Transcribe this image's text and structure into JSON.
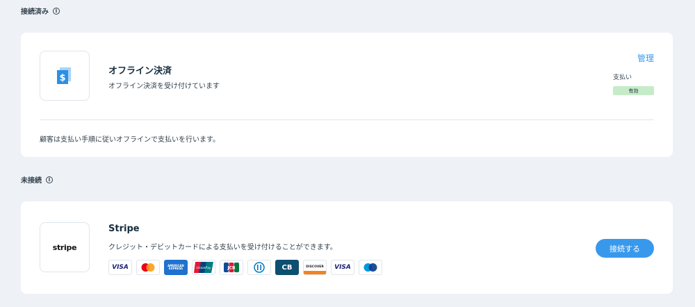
{
  "connected_section": {
    "label": "接続済み"
  },
  "offline": {
    "title": "オフライン決済",
    "description": "オフライン決済を受け付けています",
    "manage": "管理",
    "pay_label": "支払い",
    "status": "有効",
    "footer": "顧客は支払い手順に従いオフラインで支払いを行います。"
  },
  "unconnected_section": {
    "label": "未接続"
  },
  "stripe": {
    "logo_text": "stripe",
    "title": "Stripe",
    "description": "クレジット・デビットカードによる支払いを受け付けることができます。",
    "connect": "接続する",
    "card_icons": [
      "visa-icon",
      "mastercard-icon",
      "amex-icon",
      "unionpay-icon",
      "jcb-icon",
      "diners-icon",
      "cb-icon",
      "discover-icon",
      "visa-icon",
      "maestro-icon"
    ],
    "card_labels": {
      "visa": "VISA",
      "amex": "AMERICAN EXPRESS",
      "unionpay": "UnionPay",
      "jcb": "JCB",
      "cb": "CB",
      "discover": "DISCOVER"
    }
  },
  "colors": {
    "accent": "#3899ec",
    "status_bg": "#c6ebc9",
    "background": "#eef1f6"
  }
}
